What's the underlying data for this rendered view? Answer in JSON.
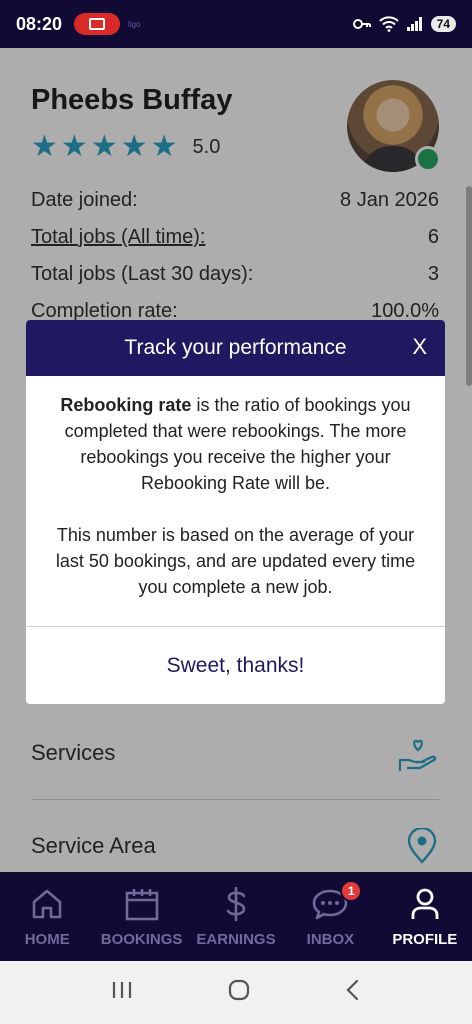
{
  "status_bar": {
    "time": "08:20",
    "battery": "74",
    "tag": "ligo"
  },
  "profile": {
    "name": "Pheebs Buffay",
    "rating": "5.0",
    "stars": 5,
    "star_icon": "star-icon"
  },
  "stats": [
    {
      "label": "Date joined:",
      "value": "8 Jan 2026"
    },
    {
      "label": "Total jobs (All time):",
      "value": "6"
    },
    {
      "label": "Total jobs (Last 30 days):",
      "value": "3"
    },
    {
      "label": "Completion rate:",
      "value": "100.0%"
    }
  ],
  "menu": [
    {
      "label": "Services",
      "icon": "heart-hand-icon"
    },
    {
      "label": "Service Area",
      "icon": "map-pin-icon"
    }
  ],
  "modal": {
    "title": "Track your performance",
    "close": "X",
    "bold_term": "Rebooking rate",
    "para1_rest": " is the ratio of bookings you completed that were rebookings. The more rebookings you receive the higher your Rebooking Rate will be.",
    "para2": "This number is based on the average of your last 50 bookings, and are updated every time you complete a new job.",
    "confirm": "Sweet, thanks!"
  },
  "tabs": [
    {
      "label": "HOME",
      "icon": "home-icon"
    },
    {
      "label": "BOOKINGS",
      "icon": "calendar-icon"
    },
    {
      "label": "EARNINGS",
      "icon": "dollar-icon"
    },
    {
      "label": "INBOX",
      "icon": "chat-bubble-icon",
      "badge": "1"
    },
    {
      "label": "PROFILE",
      "icon": "user-icon",
      "active": true
    }
  ],
  "colors": {
    "accent": "#1e1960",
    "star": "#2aa3c4",
    "online": "#27a862",
    "badge": "#e23a3a"
  }
}
